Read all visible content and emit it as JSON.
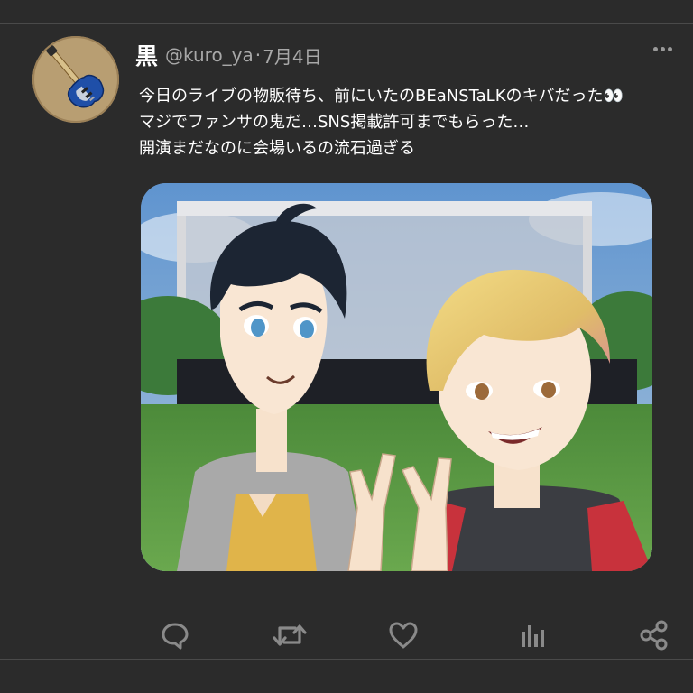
{
  "tweet": {
    "display_name": "黒",
    "handle": "@kuro_ya",
    "separator": "·",
    "date": "7月4日",
    "lines": [
      "今日のライブの物販待ち、前にいたのBEaNSTaLKのキバだった👀",
      "マジでファンサの鬼だ…SNS掲載許可までもらった…",
      "開演まだなのに会場いるの流石過ぎる"
    ]
  },
  "avatar": {
    "icon": "bass-guitar-icon",
    "background": "#b89e72"
  },
  "media": {
    "description_icon": "illustration-two-young-men-peace-sign"
  },
  "actions": [
    {
      "name": "reply",
      "icon": "speech-bubble-icon"
    },
    {
      "name": "retweet",
      "icon": "retweet-arrows-icon"
    },
    {
      "name": "like",
      "icon": "heart-icon"
    },
    {
      "name": "views",
      "icon": "bar-chart-icon"
    },
    {
      "name": "share",
      "icon": "share-nodes-icon"
    }
  ],
  "colors": {
    "background": "#2b2b2b",
    "text": "#ffffff",
    "muted": "#a8a8a8",
    "icon": "#8a8a8a",
    "divider": "#4a4a4a"
  }
}
